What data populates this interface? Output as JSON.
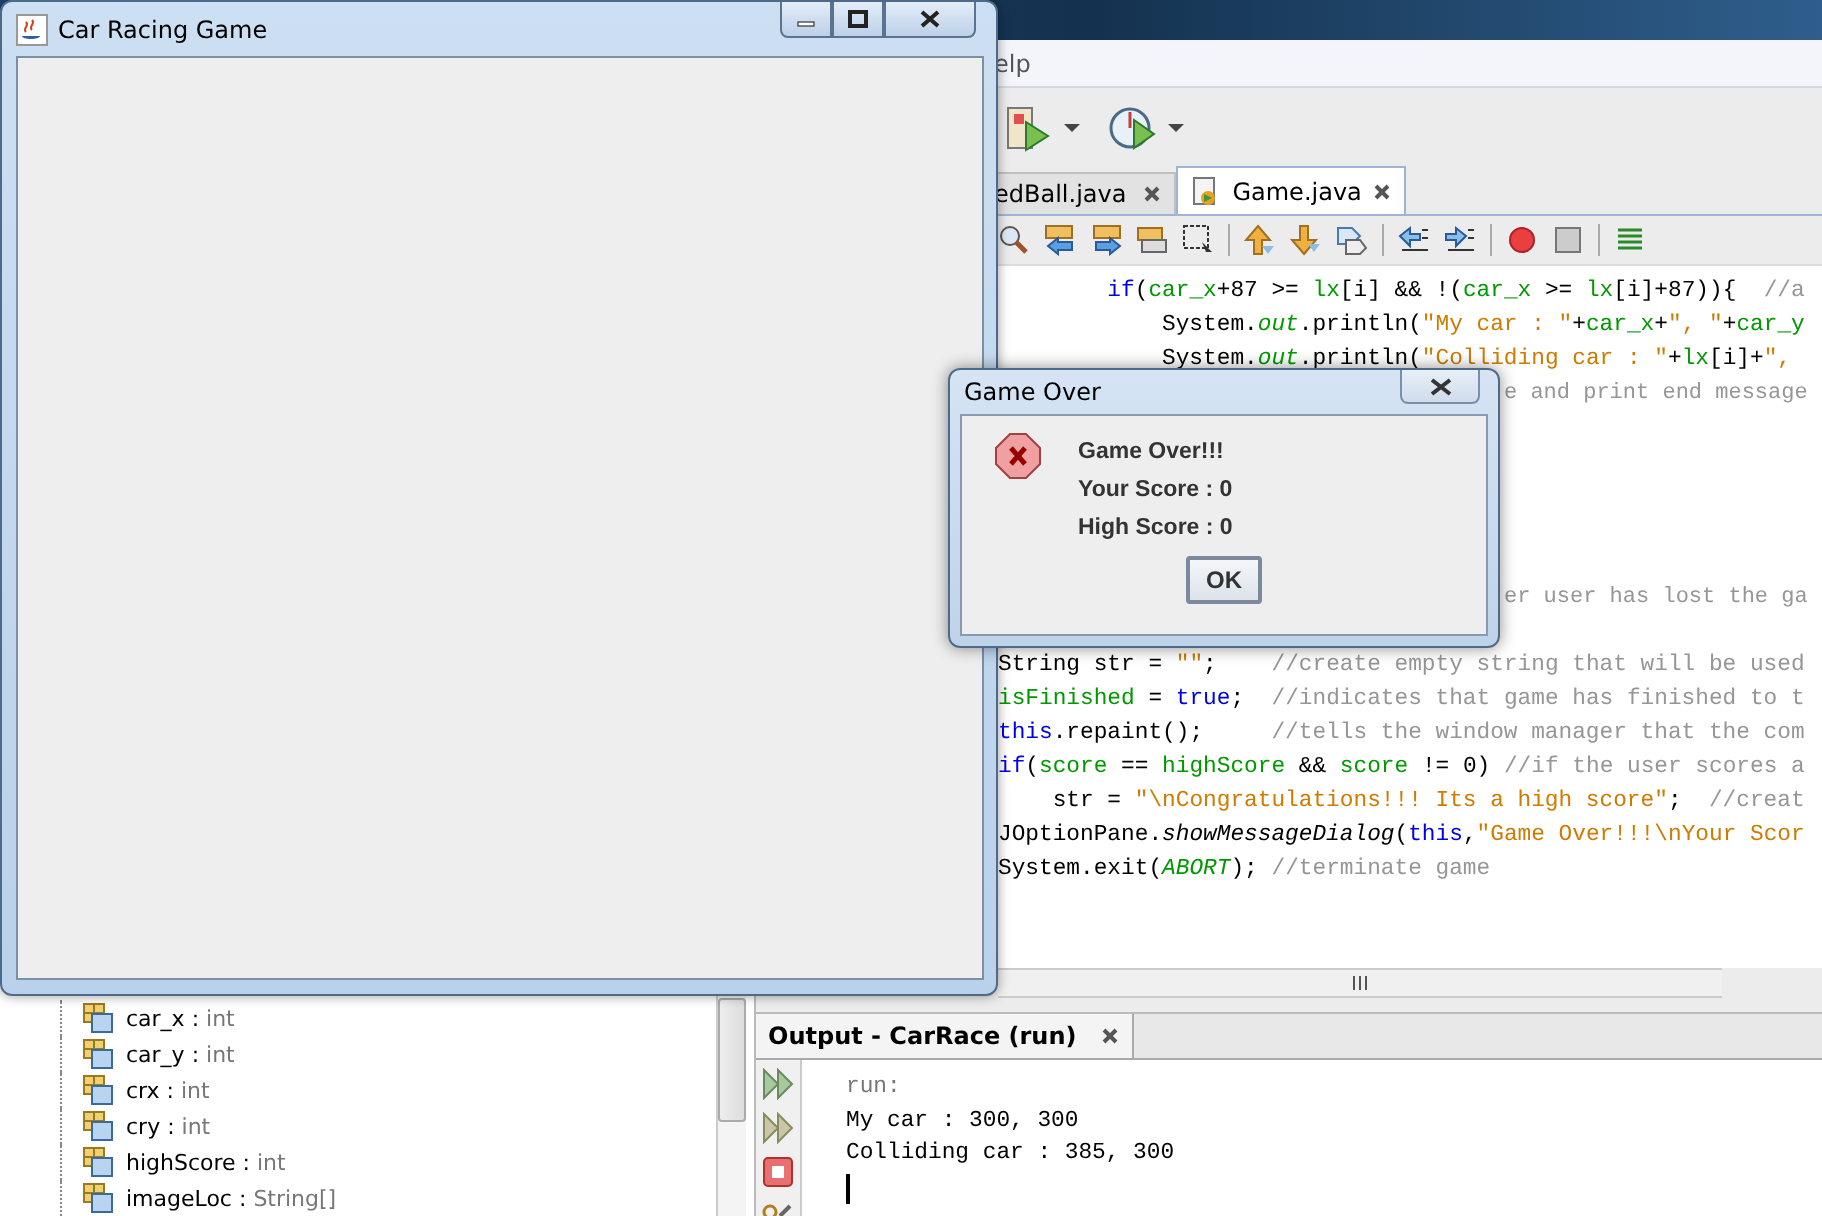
{
  "game_window": {
    "title": "Car Racing Game"
  },
  "ide": {
    "menu_item": "elp",
    "editor_tabs": [
      {
        "label": "edBall.java",
        "selected": false
      },
      {
        "label": "Game.java",
        "selected": true
      }
    ],
    "code_lines": [
      {
        "kind": "block",
        "tokens": [
          {
            "kind": "keyword",
            "text": "if"
          },
          {
            "kind": "plain",
            "text": "("
          },
          {
            "kind": "field",
            "text": "car_x"
          },
          {
            "kind": "plain",
            "text": "+87 >= "
          },
          {
            "kind": "field",
            "text": "lx"
          },
          {
            "kind": "plain",
            "text": "[i] && !("
          },
          {
            "kind": "field",
            "text": "car_x"
          },
          {
            "kind": "plain",
            "text": " >= "
          },
          {
            "kind": "field",
            "text": "lx"
          },
          {
            "kind": "plain",
            "text": "[i]+87)){  "
          },
          {
            "kind": "comment",
            "text": "//a"
          }
        ]
      },
      {
        "kind": "nested",
        "tokens": [
          {
            "kind": "plain",
            "text": "System."
          },
          {
            "kind": "static",
            "text": "out"
          },
          {
            "kind": "plain",
            "text": ".println("
          },
          {
            "kind": "string",
            "text": "\"My car : \""
          },
          {
            "kind": "plain",
            "text": "+"
          },
          {
            "kind": "field",
            "text": "car_x"
          },
          {
            "kind": "plain",
            "text": "+"
          },
          {
            "kind": "string",
            "text": "\", \""
          },
          {
            "kind": "plain",
            "text": "+"
          },
          {
            "kind": "field",
            "text": "car_y"
          }
        ]
      },
      {
        "kind": "nested",
        "tokens": [
          {
            "kind": "plain",
            "text": "System."
          },
          {
            "kind": "static",
            "text": "out"
          },
          {
            "kind": "plain",
            "text": ".println("
          },
          {
            "kind": "string",
            "text": "\"Colliding car : \""
          },
          {
            "kind": "plain",
            "text": "+"
          },
          {
            "kind": "field",
            "text": "lx"
          },
          {
            "kind": "plain",
            "text": "[i]+"
          },
          {
            "kind": "string",
            "text": "\","
          }
        ]
      },
      {
        "kind": "fragment",
        "tokens": [
          {
            "kind": "comment",
            "text": "e and print end message"
          }
        ]
      },
      {
        "kind": "blank"
      },
      {
        "kind": "blank"
      },
      {
        "kind": "blank"
      },
      {
        "kind": "blank"
      },
      {
        "kind": "blank"
      },
      {
        "kind": "fragment",
        "tokens": [
          {
            "kind": "comment",
            "text": "er user has lost the ga"
          }
        ]
      },
      {
        "kind": "blank"
      },
      {
        "kind": "code",
        "tokens": [
          {
            "kind": "plain",
            "text": "String str = "
          },
          {
            "kind": "string",
            "text": "\"\""
          },
          {
            "kind": "plain",
            "text": ";    "
          },
          {
            "kind": "comment",
            "text": "//create empty string that will be used"
          }
        ]
      },
      {
        "kind": "code",
        "tokens": [
          {
            "kind": "field",
            "text": "isFinished"
          },
          {
            "kind": "plain",
            "text": " = "
          },
          {
            "kind": "keyword",
            "text": "true"
          },
          {
            "kind": "plain",
            "text": ";  "
          },
          {
            "kind": "comment",
            "text": "//indicates that game has finished to t"
          }
        ]
      },
      {
        "kind": "code",
        "tokens": [
          {
            "kind": "keyword",
            "text": "this"
          },
          {
            "kind": "plain",
            "text": ".repaint();     "
          },
          {
            "kind": "comment",
            "text": "//tells the window manager that the com"
          }
        ]
      },
      {
        "kind": "code",
        "tokens": [
          {
            "kind": "keyword",
            "text": "if"
          },
          {
            "kind": "plain",
            "text": "("
          },
          {
            "kind": "field",
            "text": "score"
          },
          {
            "kind": "plain",
            "text": " == "
          },
          {
            "kind": "field",
            "text": "highScore"
          },
          {
            "kind": "plain",
            "text": " && "
          },
          {
            "kind": "field",
            "text": "score"
          },
          {
            "kind": "plain",
            "text": " != 0) "
          },
          {
            "kind": "comment",
            "text": "//if the user scores a"
          }
        ]
      },
      {
        "kind": "code",
        "tokens": [
          {
            "kind": "plain",
            "text": "    str = "
          },
          {
            "kind": "string",
            "text": "\"\\nCongratulations!!! Its a high score\""
          },
          {
            "kind": "plain",
            "text": ";  "
          },
          {
            "kind": "comment",
            "text": "//creat"
          }
        ]
      },
      {
        "kind": "code",
        "tokens": [
          {
            "kind": "plain",
            "text": "JOptionPane."
          },
          {
            "kind": "method",
            "text": "showMessageDialog"
          },
          {
            "kind": "plain",
            "text": "("
          },
          {
            "kind": "keyword",
            "text": "this"
          },
          {
            "kind": "plain",
            "text": ","
          },
          {
            "kind": "string",
            "text": "\"Game Over!!!\\nYour Scor"
          }
        ]
      },
      {
        "kind": "code",
        "tokens": [
          {
            "kind": "plain",
            "text": "System.exit("
          },
          {
            "kind": "static",
            "text": "ABORT"
          },
          {
            "kind": "plain",
            "text": "); "
          },
          {
            "kind": "comment",
            "text": "//terminate game"
          }
        ]
      }
    ],
    "navigator_items": [
      {
        "name": "car_x",
        "separator": ":",
        "type": "int"
      },
      {
        "name": "car_y",
        "separator": ":",
        "type": "int"
      },
      {
        "name": "crx",
        "separator": ":",
        "type": "int"
      },
      {
        "name": "cry",
        "separator": ":",
        "type": "int"
      },
      {
        "name": "highScore",
        "separator": ":",
        "type": "int"
      },
      {
        "name": "imageLoc",
        "separator": ":",
        "type": "String[]"
      }
    ],
    "output": {
      "title": "Output - CarRace (run)",
      "lines": [
        {
          "kind": "info",
          "text": "run:"
        },
        {
          "kind": "plain",
          "text": "My car : 300, 300"
        },
        {
          "kind": "plain",
          "text": "Colliding car : 385, 300"
        }
      ]
    }
  },
  "dialog": {
    "title": "Game Over",
    "message_lines": [
      "Game Over!!!",
      "Your Score : 0",
      "High Score : 0"
    ],
    "button": "OK"
  }
}
